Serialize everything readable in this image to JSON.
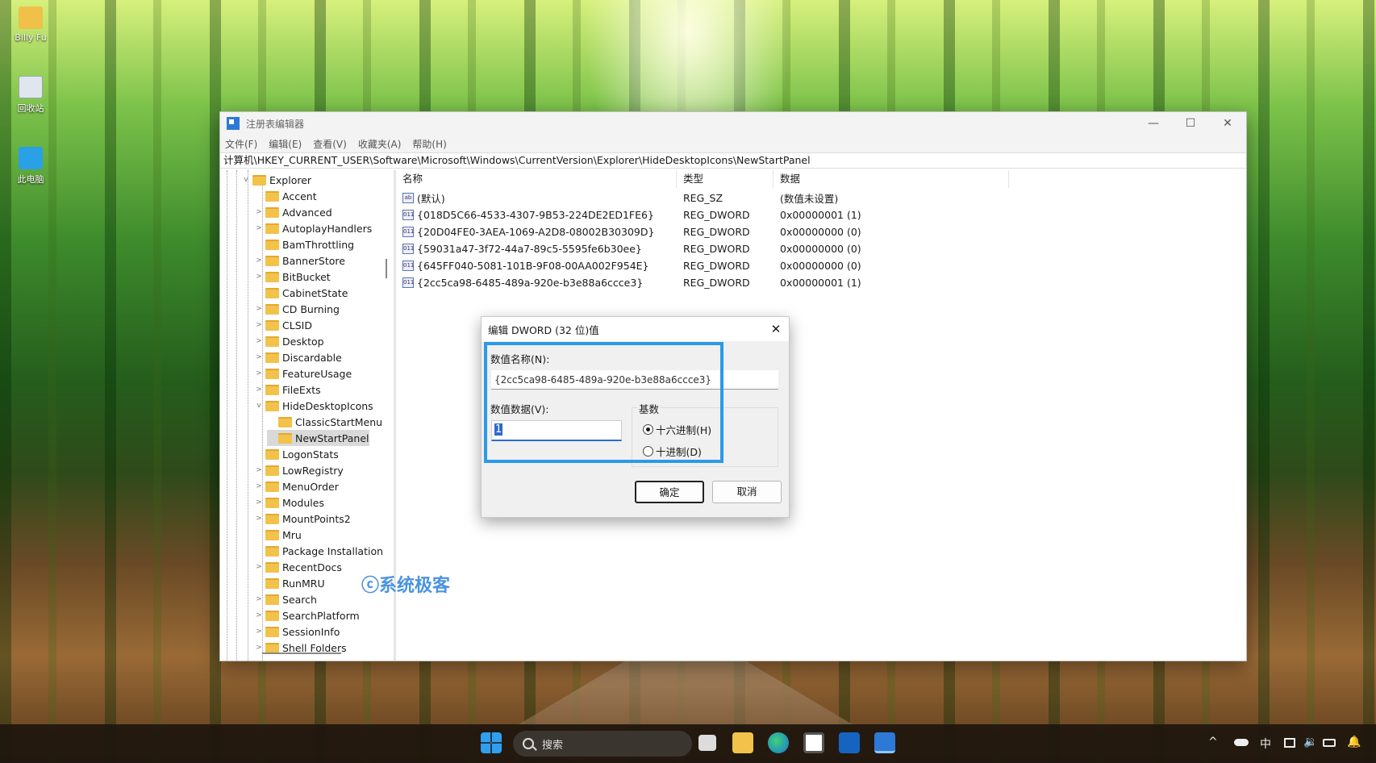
{
  "desktop": {
    "icons": [
      {
        "label": "Billy Fu"
      },
      {
        "label": "回收站"
      },
      {
        "label": "此电脑"
      }
    ]
  },
  "window": {
    "title": "注册表编辑器",
    "controls": {
      "minimize": "—",
      "maximize": "☐",
      "close": "✕"
    },
    "menu": [
      "文件(F)",
      "编辑(E)",
      "查看(V)",
      "收藏夹(A)",
      "帮助(H)"
    ],
    "address": "计算机\\HKEY_CURRENT_USER\\Software\\Microsoft\\Windows\\CurrentVersion\\Explorer\\HideDesktopIcons\\NewStartPanel"
  },
  "tree": {
    "items": [
      {
        "label": "Explorer",
        "expander": "v"
      },
      {
        "label": "Accent",
        "expander": ""
      },
      {
        "label": "Advanced",
        "expander": ">"
      },
      {
        "label": "AutoplayHandlers",
        "expander": ">"
      },
      {
        "label": "BamThrottling",
        "expander": ""
      },
      {
        "label": "BannerStore",
        "expander": ">"
      },
      {
        "label": "BitBucket",
        "expander": ">"
      },
      {
        "label": "CabinetState",
        "expander": ""
      },
      {
        "label": "CD Burning",
        "expander": ">"
      },
      {
        "label": "CLSID",
        "expander": ">"
      },
      {
        "label": "Desktop",
        "expander": ">"
      },
      {
        "label": "Discardable",
        "expander": ">"
      },
      {
        "label": "FeatureUsage",
        "expander": ">"
      },
      {
        "label": "FileExts",
        "expander": ">"
      },
      {
        "label": "HideDesktopIcons",
        "expander": "v"
      },
      {
        "label": "ClassicStartMenu",
        "expander": ""
      },
      {
        "label": "NewStartPanel",
        "expander": ""
      },
      {
        "label": "LogonStats",
        "expander": ""
      },
      {
        "label": "LowRegistry",
        "expander": ">"
      },
      {
        "label": "MenuOrder",
        "expander": ">"
      },
      {
        "label": "Modules",
        "expander": ">"
      },
      {
        "label": "MountPoints2",
        "expander": ">"
      },
      {
        "label": "Mru",
        "expander": ""
      },
      {
        "label": "Package Installation",
        "expander": ""
      },
      {
        "label": "RecentDocs",
        "expander": ">"
      },
      {
        "label": "RunMRU",
        "expander": ""
      },
      {
        "label": "Search",
        "expander": ">"
      },
      {
        "label": "SearchPlatform",
        "expander": ">"
      },
      {
        "label": "SessionInfo",
        "expander": ">"
      },
      {
        "label": "Shell Folders",
        "expander": ">"
      }
    ]
  },
  "values": {
    "headers": [
      "名称",
      "类型",
      "数据"
    ],
    "rows": [
      {
        "icon": "ab",
        "name": "(默认)",
        "type": "REG_SZ",
        "data": "(数值未设置)"
      },
      {
        "icon": "011",
        "name": "{018D5C66-4533-4307-9B53-224DE2ED1FE6}",
        "type": "REG_DWORD",
        "data": "0x00000001 (1)"
      },
      {
        "icon": "011",
        "name": "{20D04FE0-3AEA-1069-A2D8-08002B30309D}",
        "type": "REG_DWORD",
        "data": "0x00000000 (0)"
      },
      {
        "icon": "011",
        "name": "{59031a47-3f72-44a7-89c5-5595fe6b30ee}",
        "type": "REG_DWORD",
        "data": "0x00000000 (0)"
      },
      {
        "icon": "011",
        "name": "{645FF040-5081-101B-9F08-00AA002F954E}",
        "type": "REG_DWORD",
        "data": "0x00000000 (0)"
      },
      {
        "icon": "011",
        "name": "{2cc5ca98-6485-489a-920e-b3e88a6ccce3}",
        "type": "REG_DWORD",
        "data": "0x00000001 (1)"
      }
    ]
  },
  "watermark": "系统极客",
  "dialog": {
    "title": "编辑 DWORD (32 位)值",
    "close": "✕",
    "name_label": "数值名称(N):",
    "name_value": "{2cc5ca98-6485-489a-920e-b3e88a6ccce3}",
    "data_label": "数值数据(V):",
    "data_value": "1",
    "base_label": "基数",
    "hex_label": "十六进制(H)",
    "dec_label": "十进制(D)",
    "selected_base": "hex",
    "ok": "确定",
    "cancel": "取消"
  },
  "taskbar": {
    "search_placeholder": "搜索",
    "apps": [
      "start-icon",
      "task-view-icon",
      "file-explorer-icon",
      "edge-icon",
      "store-icon",
      "outlook-icon",
      "regedit-icon"
    ],
    "tray": {
      "chevron": "^",
      "ime": "中"
    }
  }
}
